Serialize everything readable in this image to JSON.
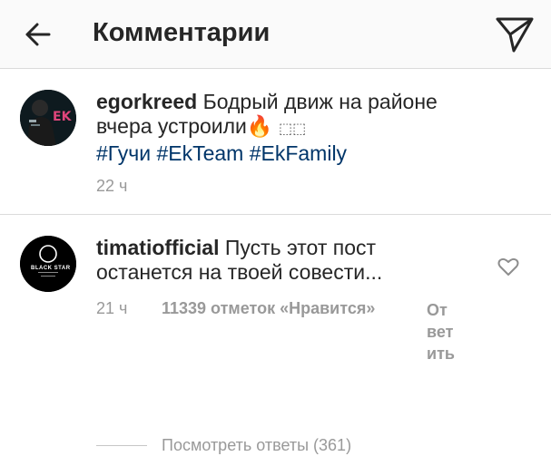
{
  "header": {
    "title": "Комментарии",
    "back_icon": "arrow-left-icon",
    "send_icon": "paper-plane-icon"
  },
  "caption": {
    "username": "egorkreed",
    "text_line1": "Бодрый движ на районе",
    "text_line2": "вчера устроили",
    "emoji": "🔥",
    "emoji_extra": "⬚⬚",
    "hashtags": [
      "#Гучи",
      "#EkTeam",
      "#EkFamily"
    ],
    "time": "22 ч",
    "avatar_logo_text": "EK"
  },
  "comment": {
    "username": "timatiofficial",
    "text_line1": "Пусть этот пост",
    "text_line2": "останется на твоей совести...",
    "time": "21 ч",
    "likes": "11339 отметок «Нравится»",
    "reply": "Ответить",
    "view_replies": "Посмотреть ответы (361)",
    "avatar_logo_text": "BLACK STAR"
  },
  "colors": {
    "text": "#262626",
    "muted": "#999999",
    "hashtag": "#003569",
    "divider": "#dbdbdb",
    "header_bg": "#fafafa"
  }
}
